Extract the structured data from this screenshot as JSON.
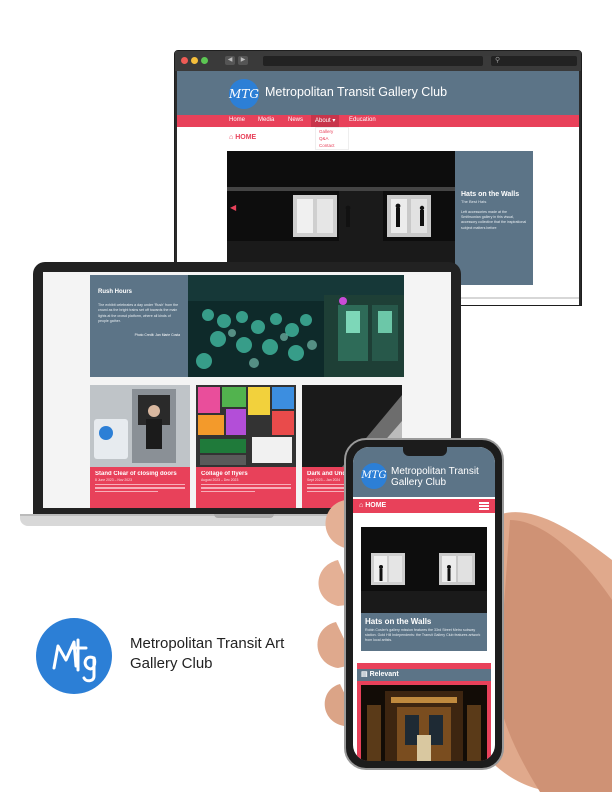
{
  "brand": {
    "name_line1": "Metropolitan Transit Art",
    "name_line2": "Gallery Club",
    "logo_text": "MTG",
    "accent": "#e8415a",
    "header_blue": "#5c7487",
    "logo_blue": "#2c7fd6"
  },
  "desktop": {
    "site_title": "Metropolitan Transit Gallery Club",
    "nav": [
      "Home",
      "Media",
      "News",
      "About ▾",
      "Education"
    ],
    "dropdown": [
      "Gallery",
      "Q&A",
      "Contact"
    ],
    "home_label": "HOME",
    "feature": {
      "title": "Hats on the Walls",
      "subtitle": "The Best Hats",
      "body": "Left accessories made at the Smithsonian gallery in this visual, accessory collective that the inspirational subject matters before"
    }
  },
  "laptop": {
    "feature": {
      "title": "Rush Hours",
      "body": "The exhibit celebrates a day under 'Rush' from the crowd as the bright trains set off towards the main lights at the crowd platform, where all kinds of people gather.",
      "credit": "Photo Credit: Jan Marie Costa"
    },
    "cards": [
      {
        "title": "Stand Clear of closing doors",
        "date": "8 June 2023 – Nov 2023"
      },
      {
        "title": "Collage of flyers",
        "date": "August 2023 – Dec 2023"
      },
      {
        "title": "Dark and Underground",
        "date": "Sept 2023 – Jan 2024"
      }
    ]
  },
  "phone": {
    "site_title": "Metropolitan Transit Gallery Club",
    "home_label": "HOME",
    "feature": {
      "title": "Hats on the Walls",
      "body": "Robin Cosler's gallery mission features the 33rd Street Metro subway station. Gold Hill Independents: the Transit Gallery Club features artwork from local artists."
    },
    "relevant_label": "Relevant"
  }
}
